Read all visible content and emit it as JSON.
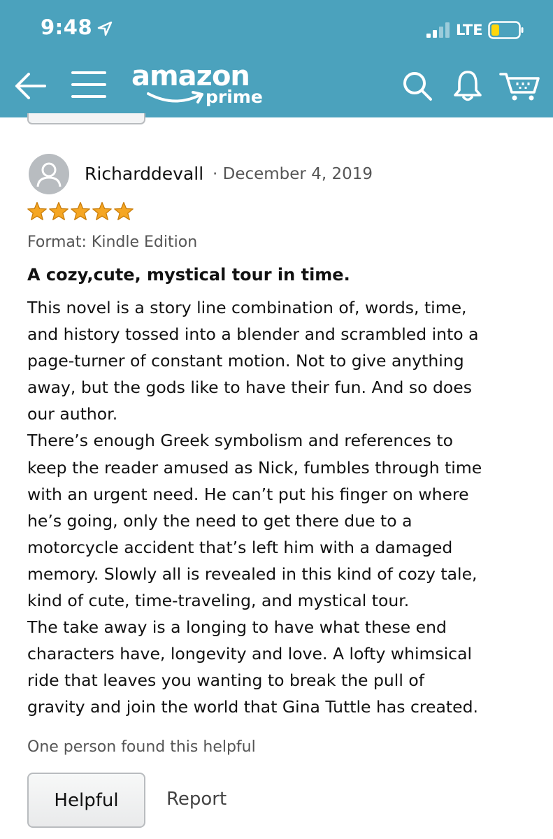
{
  "status_bar": {
    "time": "9:48",
    "network": "LTE",
    "icons": [
      "location-arrow-icon",
      "signal-bars-icon",
      "battery-low-icon"
    ]
  },
  "nav": {
    "logo_word": "amazon",
    "logo_sub": "prime",
    "icons": [
      "back-arrow-icon",
      "hamburger-menu-icon",
      "search-icon",
      "bell-icon",
      "cart-icon"
    ],
    "bar_color": "#4ba2bd"
  },
  "review": {
    "reviewer": "Richarddevall",
    "separator": "·",
    "date": "December 4, 2019",
    "rating": 5,
    "rating_max": 5,
    "star_color": "#f5a623",
    "format": "Format: Kindle Edition",
    "title": "A cozy,cute, mystical tour in time.",
    "body_lines": [
      "This novel is a story line combination of, words, time,",
      "and history tossed into a blender and scrambled into a",
      "page-turner of constant motion. Not to give anything",
      "away, but the gods like to have their fun. And so does",
      "our author.",
      "There’s enough Greek symbolism and references to",
      "keep the reader amused as Nick, fumbles through time",
      "with an urgent need. He can’t put his finger on where",
      "he’s going, only the need to get there due to a",
      "motorcycle accident that’s left him with a damaged",
      "memory. Slowly all is revealed in this kind of cozy tale,",
      "kind of cute, time-traveling, and mystical tour.",
      "The take away is a longing to have what these end",
      "characters have, longevity and love. A lofty whimsical",
      "ride that leaves you wanting to break the pull of",
      "gravity and join the world that Gina Tuttle has created."
    ],
    "helpful_count": "One person found this helpful",
    "helpful_label": "Helpful",
    "report_label": "Report"
  }
}
